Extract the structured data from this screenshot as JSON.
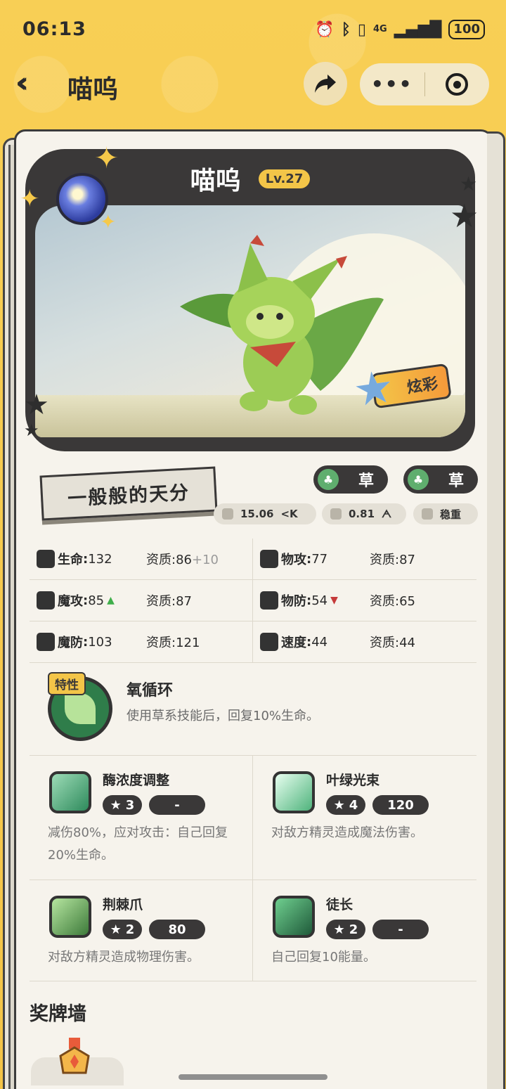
{
  "status_bar": {
    "time": "06:13",
    "network": "4G",
    "battery": "100",
    "icons": [
      "alarm-icon",
      "bluetooth-icon",
      "vibrate-icon",
      "signal-icon",
      "battery-icon"
    ]
  },
  "nav": {
    "title": "喵呜",
    "icons": [
      "back-icon",
      "share-icon",
      "more-icon",
      "close-target-icon"
    ]
  },
  "pet": {
    "name": "喵呜",
    "level": "Lv.27",
    "shiny_label": "炫彩",
    "talent": "一般般的天分",
    "types": [
      "草",
      "草"
    ],
    "height": "15.06",
    "weight": "0.81",
    "temperament": "稳重"
  },
  "stats": [
    [
      {
        "icon": "heart-icon",
        "name": "生命",
        "value": "132",
        "aptitude": "86",
        "bonus": "+10",
        "trend": ""
      },
      {
        "icon": "sword-icon",
        "name": "物攻",
        "value": "77",
        "aptitude": "87",
        "bonus": "",
        "trend": ""
      }
    ],
    [
      {
        "icon": "magic-attack-icon",
        "name": "魔攻",
        "value": "85",
        "aptitude": "87",
        "bonus": "",
        "trend": "up"
      },
      {
        "icon": "shield-icon",
        "name": "物防",
        "value": "54",
        "aptitude": "65",
        "bonus": "",
        "trend": "down"
      }
    ],
    [
      {
        "icon": "magic-shield-icon",
        "name": "魔防",
        "value": "103",
        "aptitude": "121",
        "bonus": "",
        "trend": ""
      },
      {
        "icon": "speed-icon",
        "name": "速度",
        "value": "44",
        "aptitude": "44",
        "bonus": "",
        "trend": ""
      }
    ]
  ],
  "labels": {
    "aptitude": "资质",
    "colon": ":"
  },
  "trait": {
    "badge": "特性",
    "name": "氧循环",
    "desc": "使用草系技能后，回复10%生命。"
  },
  "skills": [
    {
      "name": "酶浓度调整",
      "star": "3",
      "cost": "-",
      "desc": "减伤80%，应对攻击：自己回复20%生命。"
    },
    {
      "name": "叶绿光束",
      "star": "4",
      "cost": "120",
      "desc": "对敌方精灵造成魔法伤害。"
    },
    {
      "name": "荆棘爪",
      "star": "2",
      "cost": "80",
      "desc": "对敌方精灵造成物理伤害。"
    },
    {
      "name": "徒长",
      "star": "2",
      "cost": "-",
      "desc": "自己回复10能量。"
    }
  ],
  "medal_wall": {
    "title": "奖牌墙"
  },
  "colors": {
    "background": "#f6c94a",
    "dark": "#3a3838",
    "grass": "#5fae6e",
    "up": "#3fae4a",
    "down": "#c53a3a"
  }
}
